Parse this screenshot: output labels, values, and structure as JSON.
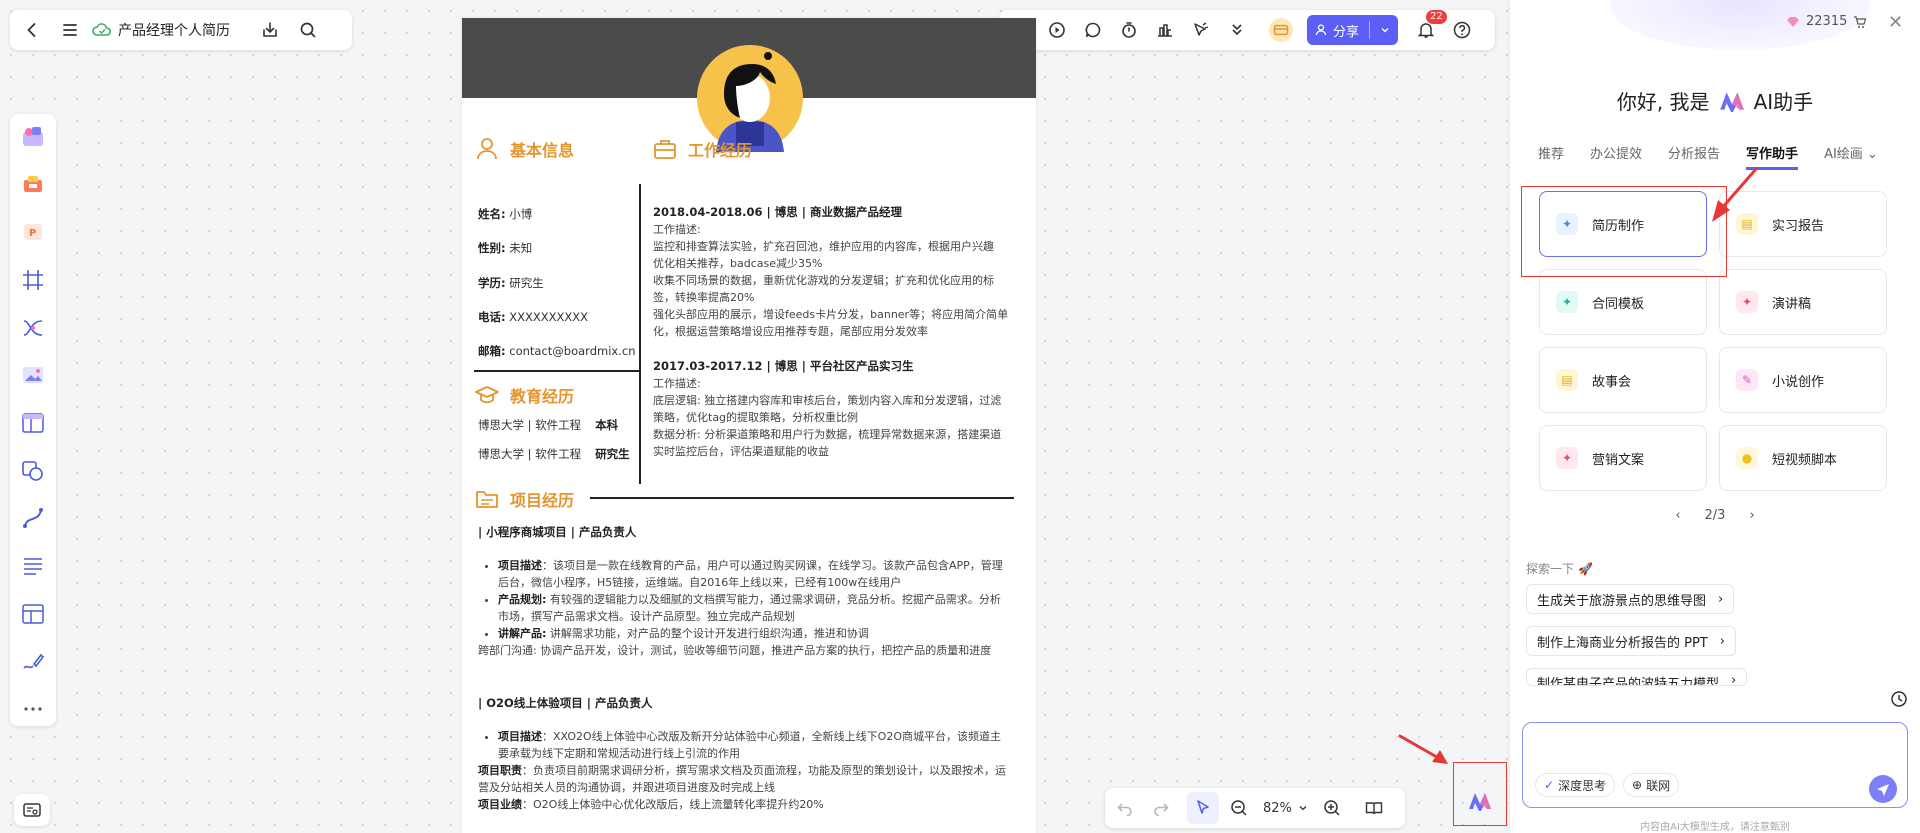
{
  "topbar": {
    "doc_title": "产品经理个人简历"
  },
  "toolbar": {
    "share_label": "分享",
    "notif_count": "22"
  },
  "resume": {
    "basic": {
      "title": "基本信息",
      "rows": [
        {
          "k": "姓名:",
          "v": "小博"
        },
        {
          "k": "性别:",
          "v": "未知"
        },
        {
          "k": "学历:",
          "v": "研究生"
        },
        {
          "k": "电话:",
          "v": "XXXXXXXXXX"
        },
        {
          "k": "邮箱:",
          "v": "contact@boardmix.cn"
        }
      ]
    },
    "education": {
      "title": "教育经历",
      "rows": [
        {
          "school": "博思大学 | 软件工程",
          "degree": "本科"
        },
        {
          "school": "博思大学 | 软件工程",
          "degree": "研究生"
        }
      ]
    },
    "work": {
      "title": "工作经历",
      "job1": {
        "head": "2018.04-2018.06 | 博思 | 商业数据产品经理",
        "l1": "工作描述:",
        "l2": "监控和排查算法实验，扩充召回池，维护应用的内容库，根据用户兴趣",
        "l3": "优化相关推荐，badcase减少35%",
        "l4": "收集不同场景的数据，重新优化游戏的分发逻辑；扩充和优化应用的标",
        "l5": "签，转换率提高20%",
        "l6": "强化头部应用的展示，增设feeds卡片分发，banner等；将应用简介简单",
        "l7": "化，根据运营策略增设应用推荐专题，尾部应用分发效率"
      },
      "job2": {
        "head": "2017.03-2017.12 | 博思 | 平台社区产品实习生",
        "l1": "工作描述:",
        "l2": "底层逻辑: 独立搭建内容库和审核后台，策划内容入库和分发逻辑，过滤",
        "l3": "策略，优化tag的提取策略，分析权重比例",
        "l4": "数据分析: 分析渠道策略和用户行为数据，梳理异常数据来源，搭建渠道",
        "l5": "实时监控后台，评估渠道赋能的收益"
      }
    },
    "projects": {
      "title": "项目经历",
      "p1": {
        "head": "| 小程序商城项目 | 产品负责人",
        "b1_label": "项目描述",
        "b1_text": "：该项目是一款在线教育的产品，用户可以通过购买网课，在线学习。该款产品包含APP，管理后台，微信小程序，H5链接，运维端。自2016年上线以来，已经有100w在线用户",
        "b2_label": "产品规划:",
        "b2_text": " 有较强的逻辑能力以及细腻的文档撰写能力，通过需求调研，竞品分析。挖掘产品需求。分析市场，撰写产品需求文档。设计产品原型。独立完成产品规划",
        "b3_label": "讲解产品:",
        "b3_text": " 讲解需求功能，对产品的整个设计开发进行组织沟通，推进和协调",
        "tail": "跨部门沟通: 协调产品开发，设计，测试，验收等细节问题，推进产品方案的执行，把控产品的质量和进度"
      },
      "p2": {
        "head": "| O2O线上体验项目 | 产品负责人",
        "b1_label": "项目描述",
        "b1_text": "：XXO2O线上体验中心改版及新开分站体验中心频道，全新线上线下O2O商城平台，该频道主要承载为线下定期和常规活动进行线上引流的作用",
        "r1_label": "项目职责",
        "r1_text": "：负责项目前期需求调研分析，撰写需求文档及页面流程，功能及原型的策划设计，以及跟按术，运营及分站相关人员的沟通协调，并跟进项目进度及时完成上线",
        "r2_label": "项目业绩",
        "r2_text": "：O2O线上体验中心优化改版后，线上流量转化率提升约20%"
      }
    }
  },
  "bottombar": {
    "zoom": "82%"
  },
  "ai_panel": {
    "credits": "22315",
    "greeting_prefix": "你好, 我是",
    "greeting_suffix": "AI助手",
    "tabs": [
      "推荐",
      "办公提效",
      "分析报告",
      "写作助手",
      "AI绘画"
    ],
    "active_tab": "写作助手",
    "cards": [
      "简历制作",
      "实习报告",
      "合同模板",
      "演讲稿",
      "故事会",
      "小说创作",
      "营销文案",
      "短视频脚本"
    ],
    "pager": "2/3",
    "explore_title": "探索一下",
    "suggestions": [
      "生成关于旅游景点的思维导图",
      "制作上海商业分析报告的 PPT",
      "制作某电子产品的波特五力模型"
    ],
    "options": {
      "deep_think": "深度思考",
      "web": "联网"
    },
    "disclaimer": "内容由AI大模型生成，请注意甄别"
  },
  "colors": {
    "accent": "#5b5ff5",
    "resume_orange": "#e4952c",
    "annotation_red": "#e53935"
  }
}
